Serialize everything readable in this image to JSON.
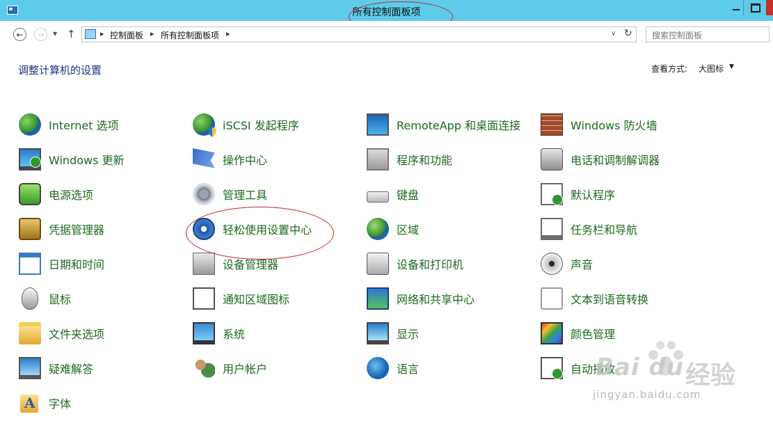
{
  "window": {
    "title": "所有控制面板项"
  },
  "address_bar": {
    "breadcrumbs": [
      "控制面板",
      "所有控制面板项"
    ]
  },
  "search": {
    "placeholder": "搜索控制面板"
  },
  "main": {
    "heading": "调整计算机的设置",
    "view_by": {
      "label": "查看方式:",
      "value": "大图标"
    }
  },
  "items": {
    "col1": [
      {
        "label": "Internet 选项",
        "icon": "internet-options-icon"
      },
      {
        "label": "Windows 更新",
        "icon": "windows-update-icon"
      },
      {
        "label": "电源选项",
        "icon": "power-options-icon"
      },
      {
        "label": "凭据管理器",
        "icon": "credential-manager-icon"
      },
      {
        "label": "日期和时间",
        "icon": "date-time-icon"
      },
      {
        "label": "鼠标",
        "icon": "mouse-icon"
      },
      {
        "label": "文件夹选项",
        "icon": "folder-options-icon"
      },
      {
        "label": "疑难解答",
        "icon": "troubleshooting-icon"
      },
      {
        "label": "字体",
        "icon": "fonts-icon"
      }
    ],
    "col2": [
      {
        "label": "iSCSI 发起程序",
        "icon": "iscsi-initiator-icon"
      },
      {
        "label": "操作中心",
        "icon": "action-center-icon"
      },
      {
        "label": "管理工具",
        "icon": "administrative-tools-icon"
      },
      {
        "label": "轻松使用设置中心",
        "icon": "ease-of-access-icon"
      },
      {
        "label": "设备管理器",
        "icon": "device-manager-icon"
      },
      {
        "label": "通知区域图标",
        "icon": "notification-area-icon"
      },
      {
        "label": "系统",
        "icon": "system-icon"
      },
      {
        "label": "用户帐户",
        "icon": "user-accounts-icon"
      }
    ],
    "col3": [
      {
        "label": "RemoteApp 和桌面连接",
        "icon": "remoteapp-icon"
      },
      {
        "label": "程序和功能",
        "icon": "programs-features-icon"
      },
      {
        "label": "键盘",
        "icon": "keyboard-icon"
      },
      {
        "label": "区域",
        "icon": "region-icon"
      },
      {
        "label": "设备和打印机",
        "icon": "devices-printers-icon"
      },
      {
        "label": "网络和共享中心",
        "icon": "network-sharing-icon"
      },
      {
        "label": "显示",
        "icon": "display-icon"
      },
      {
        "label": "语言",
        "icon": "language-icon"
      }
    ],
    "col4": [
      {
        "label": "Windows 防火墙",
        "icon": "firewall-icon"
      },
      {
        "label": "电话和调制解调器",
        "icon": "phone-modem-icon"
      },
      {
        "label": "默认程序",
        "icon": "default-programs-icon"
      },
      {
        "label": "任务栏和导航",
        "icon": "taskbar-navigation-icon"
      },
      {
        "label": "声音",
        "icon": "sound-icon"
      },
      {
        "label": "文本到语音转换",
        "icon": "text-to-speech-icon"
      },
      {
        "label": "颜色管理",
        "icon": "color-management-icon"
      },
      {
        "label": "自动播放",
        "icon": "autoplay-icon"
      }
    ]
  },
  "watermark": {
    "brand": "Bai du",
    "site_cn": "经验",
    "url": "jingyan.baidu.com"
  },
  "colors": {
    "titlebar": "#5dcbea",
    "heading": "#1e3287",
    "item_label": "#1c6a1c",
    "annotation": "#c0282d"
  }
}
